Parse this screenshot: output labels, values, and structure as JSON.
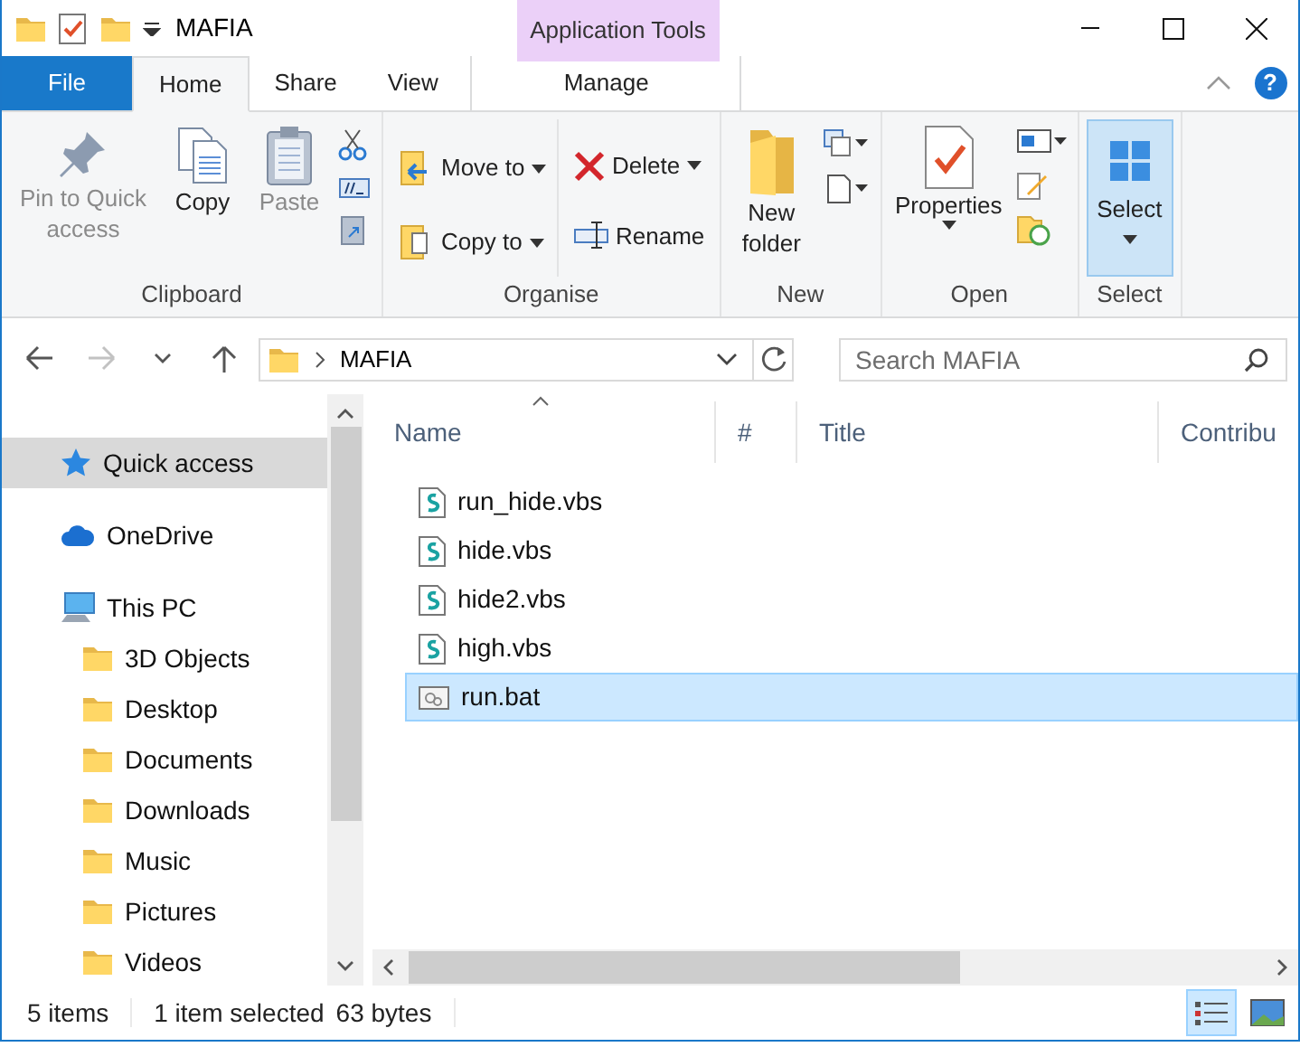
{
  "window": {
    "title": "MAFIA",
    "context_header": "Application Tools",
    "help": "?"
  },
  "tabs": [
    {
      "label": "File",
      "kind": "file",
      "selected": false
    },
    {
      "label": "Home",
      "kind": "tab",
      "selected": true
    },
    {
      "label": "Share",
      "kind": "tab",
      "selected": false
    },
    {
      "label": "View",
      "kind": "tab",
      "selected": false
    },
    {
      "label": "Manage",
      "kind": "context",
      "selected": false
    }
  ],
  "ribbon": {
    "groups": [
      {
        "label": "Clipboard",
        "buttons": [
          {
            "label": "Pin to Quick access",
            "disabled": true
          },
          {
            "label": "Copy",
            "disabled": false
          },
          {
            "label": "Paste",
            "disabled": true
          }
        ]
      },
      {
        "label": "Organise",
        "buttons": [
          {
            "label": "Move to",
            "dropdown": true
          },
          {
            "label": "Copy to",
            "dropdown": true
          },
          {
            "label": "Delete",
            "dropdown": true
          },
          {
            "label": "Rename",
            "dropdown": false
          }
        ]
      },
      {
        "label": "New",
        "buttons": [
          {
            "label": "New folder"
          }
        ]
      },
      {
        "label": "Open",
        "buttons": [
          {
            "label": "Properties",
            "dropdown": true
          }
        ]
      },
      {
        "label": "Select",
        "buttons": [
          {
            "label": "Select",
            "dropdown": true,
            "pressed": true
          }
        ]
      }
    ]
  },
  "nav_buttons": [
    {
      "kind": "back",
      "disabled": false
    },
    {
      "kind": "forward",
      "disabled": true
    },
    {
      "kind": "recent",
      "disabled": false
    },
    {
      "kind": "up",
      "disabled": false
    }
  ],
  "address": {
    "path": "MAFIA"
  },
  "search": {
    "placeholder": "Search MAFIA"
  },
  "sidebar": {
    "items": [
      {
        "label": "Quick access",
        "kind": "quick",
        "selected": true
      },
      {
        "label": "OneDrive",
        "kind": "cloud",
        "selected": false
      },
      {
        "label": "This PC",
        "kind": "pc",
        "selected": false,
        "children": [
          {
            "label": "3D Objects",
            "kind": "folder",
            "selected": false
          },
          {
            "label": "Desktop",
            "kind": "folder",
            "selected": false
          },
          {
            "label": "Documents",
            "kind": "folder",
            "selected": false
          },
          {
            "label": "Downloads",
            "kind": "folder",
            "selected": false
          },
          {
            "label": "Music",
            "kind": "folder",
            "selected": false
          },
          {
            "label": "Pictures",
            "kind": "folder",
            "selected": false
          },
          {
            "label": "Videos",
            "kind": "folder",
            "selected": false
          }
        ]
      }
    ]
  },
  "columns": [
    {
      "label": "Name",
      "sorted": true
    },
    {
      "label": "#",
      "sorted": false
    },
    {
      "label": "Title",
      "sorted": false
    },
    {
      "label": "Contribu",
      "sorted": false
    }
  ],
  "files": [
    {
      "name": "run_hide.vbs",
      "kind": "script",
      "selected": false
    },
    {
      "name": "hide.vbs",
      "kind": "script",
      "selected": false
    },
    {
      "name": "hide2.vbs",
      "kind": "script",
      "selected": false
    },
    {
      "name": "high.vbs",
      "kind": "script",
      "selected": false
    },
    {
      "name": "run.bat",
      "kind": "batch",
      "selected": true
    }
  ],
  "status_bar": {
    "count": "5 items",
    "selection": "1 item selected",
    "size": "63 bytes"
  },
  "views": [
    {
      "kind": "details",
      "selected": true
    },
    {
      "kind": "large",
      "selected": false
    }
  ]
}
